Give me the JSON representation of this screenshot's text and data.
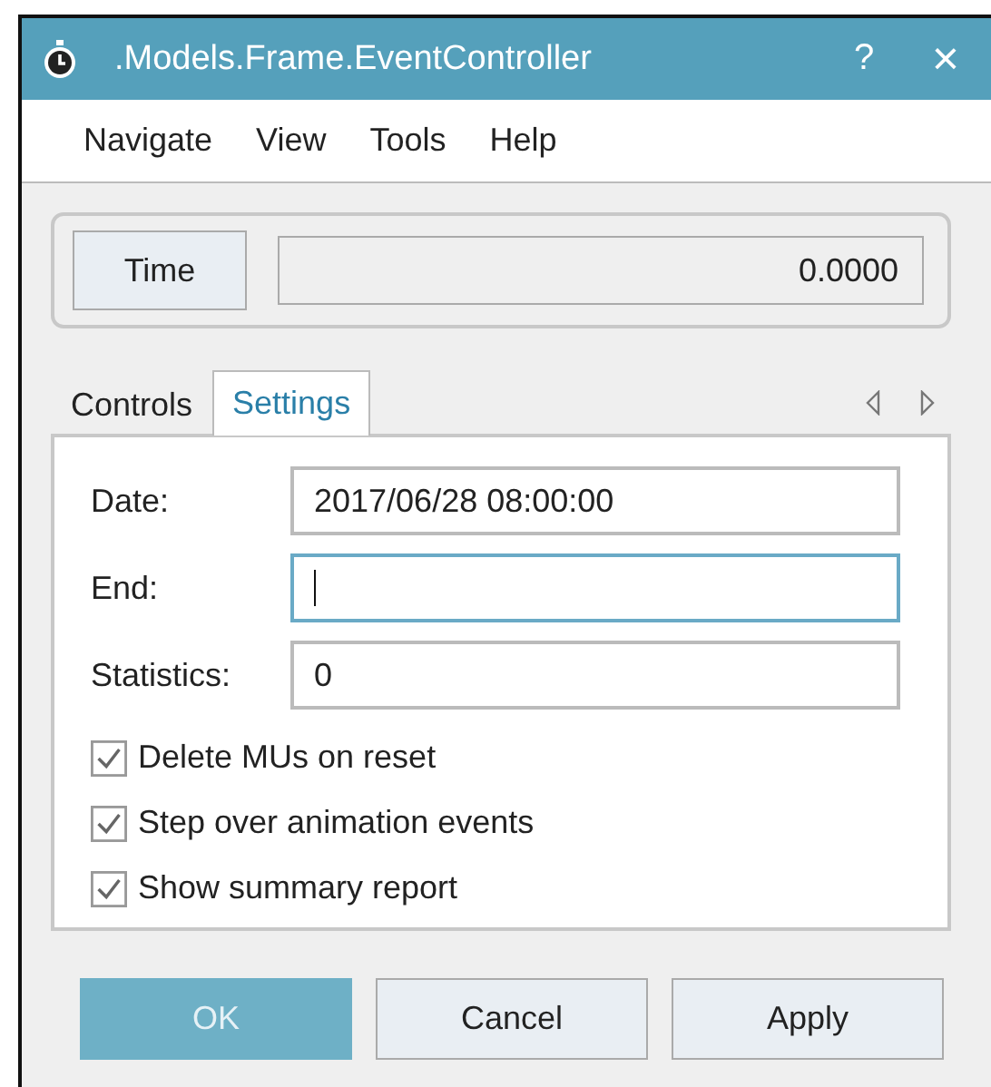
{
  "window": {
    "title": ".Models.Frame.EventController",
    "help": "?",
    "close": "×"
  },
  "menu": [
    "Navigate",
    "View",
    "Tools",
    "Help"
  ],
  "time": {
    "button": "Time",
    "value": "0.0000"
  },
  "tabs": [
    {
      "label": "Controls",
      "selected": false
    },
    {
      "label": "Settings",
      "selected": true
    }
  ],
  "fields": [
    {
      "label": "Date:",
      "value": "2017/06/28 08:00:00",
      "focused": false
    },
    {
      "label": "End:",
      "focused": true
    },
    {
      "label": "Statistics:",
      "value": "0",
      "focused": false
    }
  ],
  "checkboxes": [
    {
      "label": "Delete MUs on reset",
      "checked": true
    },
    {
      "label": "Step over animation events",
      "checked": true
    },
    {
      "label": "Show summary report",
      "checked": true
    }
  ],
  "buttons": [
    {
      "label": "OK",
      "default": true
    },
    {
      "label": "Cancel",
      "default": false
    },
    {
      "label": "Apply",
      "default": false
    }
  ]
}
